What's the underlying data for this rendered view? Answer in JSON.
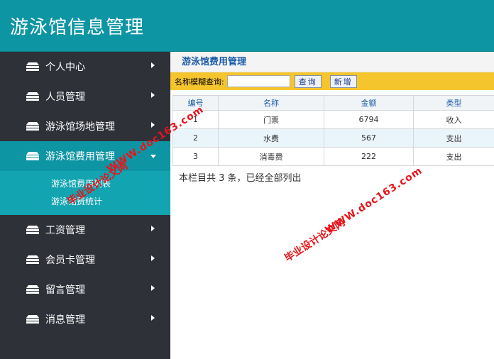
{
  "app": {
    "title": "游泳馆信息管理"
  },
  "sidebar": {
    "items": [
      {
        "label": "个人中心",
        "icon": "menu-icon"
      },
      {
        "label": "人员管理",
        "icon": "menu-icon"
      },
      {
        "label": "游泳馆场地管理",
        "icon": "menu-icon"
      },
      {
        "label": "游泳馆费用管理",
        "icon": "menu-icon",
        "expanded": true,
        "children": [
          {
            "label": "游泳馆费用列表"
          },
          {
            "label": "游泳馆费统计"
          }
        ]
      },
      {
        "label": "工资管理",
        "icon": "menu-icon"
      },
      {
        "label": "会员卡管理",
        "icon": "menu-icon"
      },
      {
        "label": "留言管理",
        "icon": "menu-icon"
      },
      {
        "label": "消息管理",
        "icon": "menu-icon"
      }
    ]
  },
  "main": {
    "breadcrumb": "游泳馆费用管理",
    "search": {
      "label": "名称模糊查询:",
      "value": "",
      "query_button": "查询",
      "add_button": "新增"
    },
    "table": {
      "columns": [
        "编号",
        "名称",
        "金额",
        "类型"
      ],
      "rows": [
        [
          "1",
          "门票",
          "6794",
          "收入"
        ],
        [
          "2",
          "水费",
          "567",
          "支出"
        ],
        [
          "3",
          "消毒费",
          "222",
          "支出"
        ]
      ]
    },
    "summary": "本栏目共 3 条，已经全部列出"
  },
  "watermark": {
    "text_a": "毕业设计论文网",
    "text_b": "WWW.doc163.com",
    "color": "#e8141b"
  }
}
